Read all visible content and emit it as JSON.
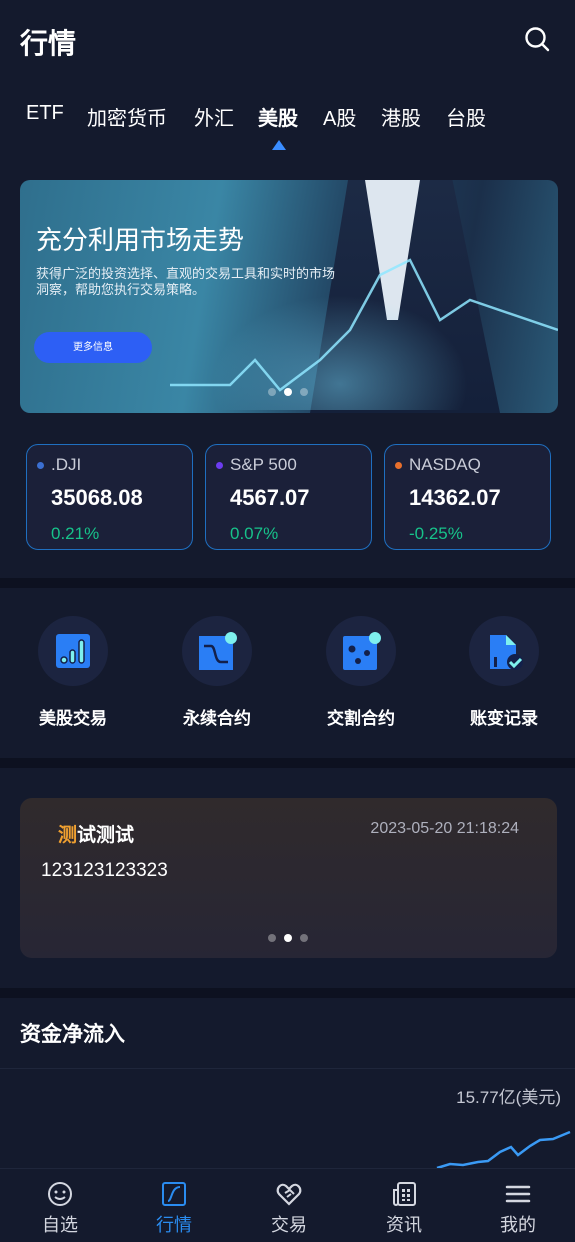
{
  "header": {
    "title": "行情",
    "search_icon": "search-icon"
  },
  "tabs": [
    {
      "label": "ETF"
    },
    {
      "label": "加密货币"
    },
    {
      "label": "外汇"
    },
    {
      "label": "美股",
      "active": true
    },
    {
      "label": "A股"
    },
    {
      "label": "港股"
    },
    {
      "label": "台股"
    }
  ],
  "banner": {
    "title": "充分利用市场走势",
    "description": "获得广泛的投资选择、直观的交易工具和实时的市场洞察，帮助您执行交易策略。",
    "button": "更多信息",
    "active_slide": 2,
    "slides": 3
  },
  "indices": [
    {
      "name": ".DJI",
      "price": "35068.08",
      "change": "0.21%",
      "dot_color": "#3b6fd1"
    },
    {
      "name": "S&P 500",
      "price": "4567.07",
      "change": "0.07%",
      "dot_color": "#6c3cf0"
    },
    {
      "name": "NASDAQ",
      "price": "14362.07",
      "change": "-0.25%",
      "dot_color": "#e86f2c"
    }
  ],
  "quick": [
    {
      "label": "美股交易",
      "icon": "bar-chart-icon"
    },
    {
      "label": "永续合约",
      "icon": "curve-chart-icon"
    },
    {
      "label": "交割合约",
      "icon": "dots-box-icon"
    },
    {
      "label": "账变记录",
      "icon": "document-check-icon"
    }
  ],
  "notice": {
    "title_highlight": "测",
    "title_rest": "试测试",
    "time": "2023-05-20 21:18:24",
    "body": "123123123323",
    "active_slide": 2,
    "slides": 3
  },
  "fund_flow": {
    "title": "资金净流入",
    "value": "15.77亿(美元)"
  },
  "nav": [
    {
      "label": "自选",
      "icon": "smiley-icon"
    },
    {
      "label": "行情",
      "icon": "chart-square-icon",
      "active": true
    },
    {
      "label": "交易",
      "icon": "handshake-heart-icon"
    },
    {
      "label": "资讯",
      "icon": "newspaper-icon"
    },
    {
      "label": "我的",
      "icon": "menu-icon"
    }
  ],
  "colors": {
    "accent": "#2a8cf0",
    "up": "#17c28a",
    "highlight": "#f0a030",
    "background": "#141a2d"
  }
}
